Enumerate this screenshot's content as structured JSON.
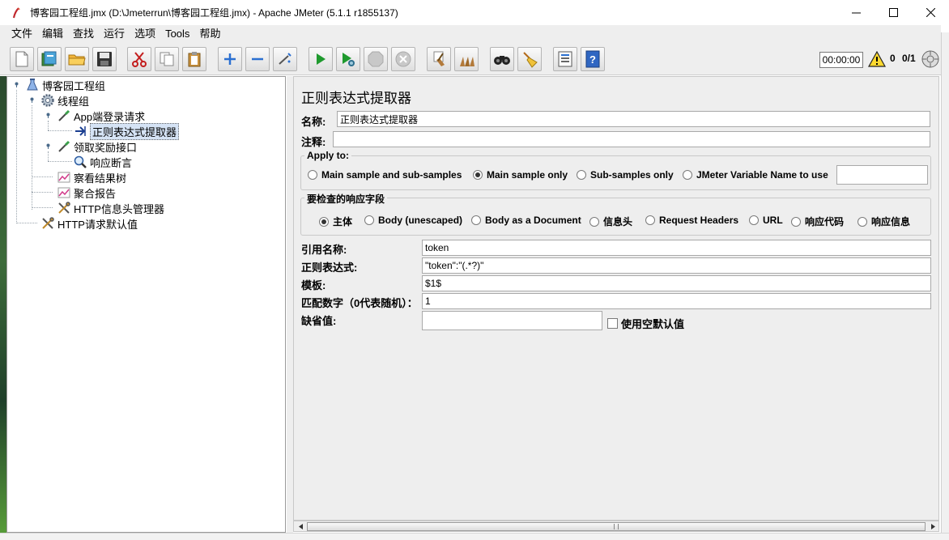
{
  "window": {
    "title": "博客园工程组.jmx (D:\\Jmeterrun\\博客园工程组.jmx) - Apache JMeter (5.1.1 r1855137)"
  },
  "menu": [
    {
      "label": "文件"
    },
    {
      "label": "编辑"
    },
    {
      "label": "查找"
    },
    {
      "label": "运行"
    },
    {
      "label": "选项"
    },
    {
      "label": "Tools"
    },
    {
      "label": "帮助"
    }
  ],
  "toolbar": {
    "elapsed_time": "00:00:00",
    "error_count": "0",
    "threads": "0/1"
  },
  "tree": [
    {
      "label": "博客园工程组",
      "icon": "test-plan-icon"
    },
    {
      "label": "线程组",
      "icon": "thread-group-icon"
    },
    {
      "label": "App端登录请求",
      "icon": "sampler-icon"
    },
    {
      "label": "正则表达式提取器",
      "icon": "post-processor-icon",
      "selected": true
    },
    {
      "label": "领取奖励接口",
      "icon": "sampler-icon"
    },
    {
      "label": "响应断言",
      "icon": "assertion-icon"
    },
    {
      "label": "察看结果树",
      "icon": "listener-icon"
    },
    {
      "label": "聚合报告",
      "icon": "listener-icon"
    },
    {
      "label": "HTTP信息头管理器",
      "icon": "config-tools-icon"
    },
    {
      "label": "HTTP请求默认值",
      "icon": "config-tools-icon"
    }
  ],
  "panel": {
    "title": "正则表达式提取器",
    "name_label": "名称:",
    "name_value": "正则表达式提取器",
    "comment_label": "注释:",
    "comment_value": "",
    "apply_to": {
      "title": "Apply to:",
      "options": [
        {
          "label": "Main sample and sub-samples",
          "selected": false
        },
        {
          "label": "Main sample only",
          "selected": true
        },
        {
          "label": "Sub-samples only",
          "selected": false
        },
        {
          "label": "JMeter Variable Name to use",
          "selected": false
        }
      ],
      "variable_value": ""
    },
    "field_to_check": {
      "title": "要检查的响应字段",
      "options": [
        {
          "label": "主体",
          "selected": true
        },
        {
          "label": "Body (unescaped)",
          "selected": false
        },
        {
          "label": "Body as a Document",
          "selected": false
        },
        {
          "label": "信息头",
          "selected": false
        },
        {
          "label": "Request Headers",
          "selected": false
        },
        {
          "label": "URL",
          "selected": false
        },
        {
          "label": "响应代码",
          "selected": false
        },
        {
          "label": "响应信息",
          "selected": false
        }
      ]
    },
    "ref_name_label": "引用名称:",
    "ref_name_value": "token",
    "regex_label": "正则表达式:",
    "regex_value": "\"token\":\"(.*?)\"",
    "template_label": "模板:",
    "template_value": "$1$",
    "match_no_label": "匹配数字（0代表随机）：",
    "match_no_value": "1",
    "default_label": "缺省值:",
    "default_value": "",
    "use_empty_label": "使用空默认值"
  }
}
